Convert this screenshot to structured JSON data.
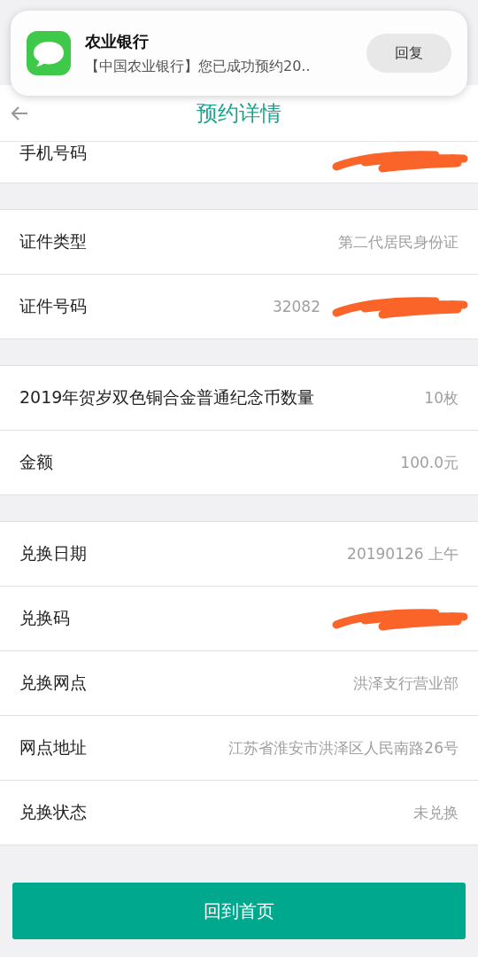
{
  "notification": {
    "app_name": "农业银行",
    "message": "【中国农业银行】您已成功预约20..",
    "reply_button": "回复"
  },
  "header": {
    "title": "预约详情"
  },
  "groups": [
    {
      "rows": [
        {
          "label": "手机号码",
          "redacted": true
        }
      ]
    },
    {
      "rows": [
        {
          "label": "证件类型",
          "value": "第二代居民身份证",
          "redacted": false
        },
        {
          "label": "证件号码",
          "value": "32082",
          "redacted": true
        }
      ]
    },
    {
      "rows": [
        {
          "label": "2019年贺岁双色铜合金普通纪念币数量",
          "value": "10枚",
          "redacted": false
        },
        {
          "label": "金额",
          "value": "100.0元",
          "redacted": false
        }
      ]
    },
    {
      "rows": [
        {
          "label": "兑换日期",
          "value": "20190126 上午",
          "redacted": false
        },
        {
          "label": "兑换码",
          "redacted": true
        },
        {
          "label": "兑换网点",
          "value": "洪泽支行营业部",
          "redacted": false
        },
        {
          "label": "网点地址",
          "value": "江苏省淮安市洪泽区人民南路26号",
          "redacted": false
        },
        {
          "label": "兑换状态",
          "value": "未兑换",
          "redacted": false
        }
      ]
    }
  ],
  "home_button": "回到首页"
}
